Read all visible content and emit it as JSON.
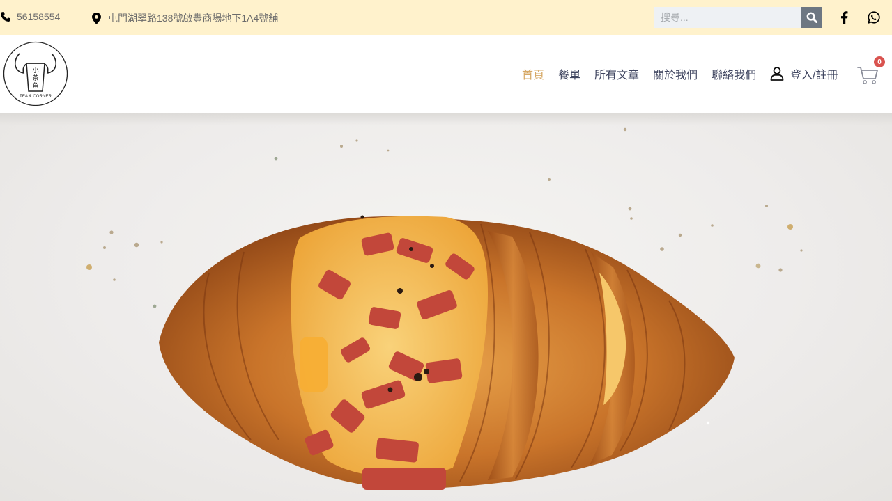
{
  "topbar": {
    "phone": "56158554",
    "address": "屯門湖翠路138號啟豐商場地下1A4號舖",
    "search": {
      "placeholder": "搜尋..."
    },
    "social": [
      "facebook-icon",
      "whatsapp-icon"
    ]
  },
  "header": {
    "logo": {
      "text_cn": "小茶角",
      "text_en": "TEA & CORNER"
    },
    "nav": [
      {
        "label": "首頁",
        "active": true
      },
      {
        "label": "餐單",
        "active": false
      },
      {
        "label": "所有文章",
        "active": false
      },
      {
        "label": "關於我們",
        "active": false
      },
      {
        "label": "聯絡我們",
        "active": false
      }
    ],
    "login_label": "登入/註冊",
    "cart_count": "0"
  },
  "colors": {
    "topbar_bg": "#fff2cc",
    "nav_text": "#3f4560",
    "nav_active": "#d6a865",
    "badge": "#d9534f",
    "search_button": "#6d7782"
  },
  "hero": {
    "image": "bacon-cheese-croissant"
  }
}
